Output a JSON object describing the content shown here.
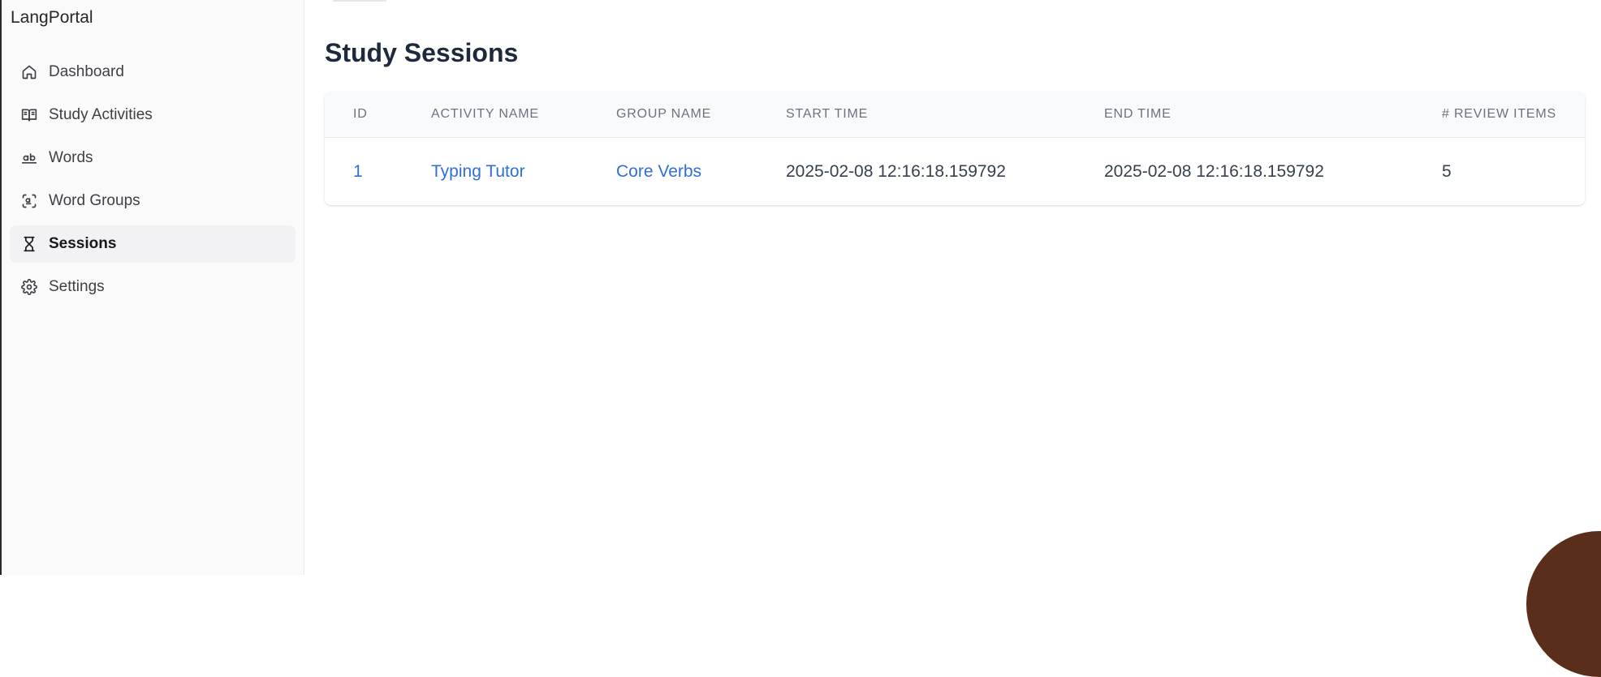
{
  "app": {
    "title": "LangPortal"
  },
  "sidebar": {
    "items": [
      {
        "label": "Dashboard",
        "icon": "home-icon",
        "active": false
      },
      {
        "label": "Study Activities",
        "icon": "book-open-icon",
        "active": false
      },
      {
        "label": "Words",
        "icon": "whole-word-icon",
        "active": false
      },
      {
        "label": "Word Groups",
        "icon": "word-groups-icon",
        "active": false
      },
      {
        "label": "Sessions",
        "icon": "hourglass-icon",
        "active": true
      },
      {
        "label": "Settings",
        "icon": "gear-icon",
        "active": false
      }
    ]
  },
  "page": {
    "title": "Study Sessions"
  },
  "table": {
    "columns": [
      "ID",
      "Activity Name",
      "Group Name",
      "Start Time",
      "End Time",
      "# Review Items"
    ],
    "rows": [
      {
        "id": "1",
        "activity_name": "Typing Tutor",
        "group_name": "Core Verbs",
        "start_time": "2025-02-08 12:16:18.159792",
        "end_time": "2025-02-08 12:16:18.159792",
        "review_items": "5"
      }
    ]
  },
  "colors": {
    "accent_link": "#2f6fd6",
    "active_bg": "#f2f2f4",
    "sidebar_bg": "#fafafa"
  }
}
